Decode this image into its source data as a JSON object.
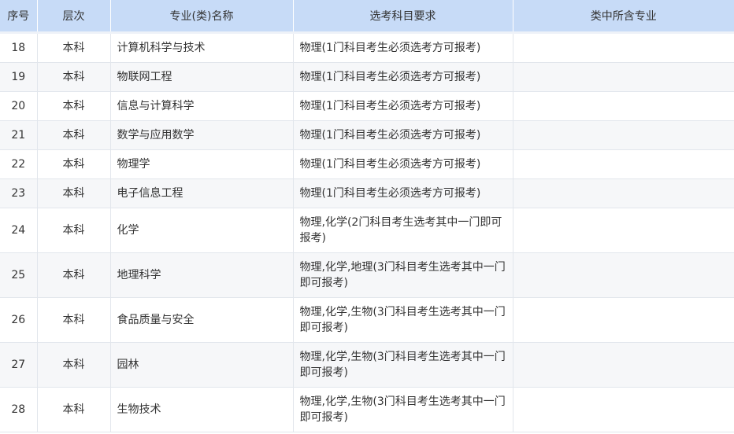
{
  "table": {
    "headers": {
      "seq": "序号",
      "level": "层次",
      "name": "专业(类)名称",
      "requirement": "选考科目要求",
      "included": "类中所含专业"
    },
    "rows": [
      {
        "seq": "18",
        "level": "本科",
        "name": "计算机科学与技术",
        "requirement": "物理(1门科目考生必须选考方可报考)",
        "included": ""
      },
      {
        "seq": "19",
        "level": "本科",
        "name": "物联网工程",
        "requirement": "物理(1门科目考生必须选考方可报考)",
        "included": ""
      },
      {
        "seq": "20",
        "level": "本科",
        "name": "信息与计算科学",
        "requirement": "物理(1门科目考生必须选考方可报考)",
        "included": ""
      },
      {
        "seq": "21",
        "level": "本科",
        "name": "数学与应用数学",
        "requirement": "物理(1门科目考生必须选考方可报考)",
        "included": ""
      },
      {
        "seq": "22",
        "level": "本科",
        "name": "物理学",
        "requirement": "物理(1门科目考生必须选考方可报考)",
        "included": ""
      },
      {
        "seq": "23",
        "level": "本科",
        "name": "电子信息工程",
        "requirement": "物理(1门科目考生必须选考方可报考)",
        "included": ""
      },
      {
        "seq": "24",
        "level": "本科",
        "name": "化学",
        "requirement": "物理,化学(2门科目考生选考其中一门即可报考)",
        "included": ""
      },
      {
        "seq": "25",
        "level": "本科",
        "name": "地理科学",
        "requirement": "物理,化学,地理(3门科目考生选考其中一门即可报考)",
        "included": ""
      },
      {
        "seq": "26",
        "level": "本科",
        "name": "食品质量与安全",
        "requirement": "物理,化学,生物(3门科目考生选考其中一门即可报考)",
        "included": ""
      },
      {
        "seq": "27",
        "level": "本科",
        "name": "园林",
        "requirement": "物理,化学,生物(3门科目考生选考其中一门即可报考)",
        "included": ""
      },
      {
        "seq": "28",
        "level": "本科",
        "name": "生物技术",
        "requirement": "物理,化学,生物(3门科目考生选考其中一门即可报考)",
        "included": ""
      }
    ]
  }
}
